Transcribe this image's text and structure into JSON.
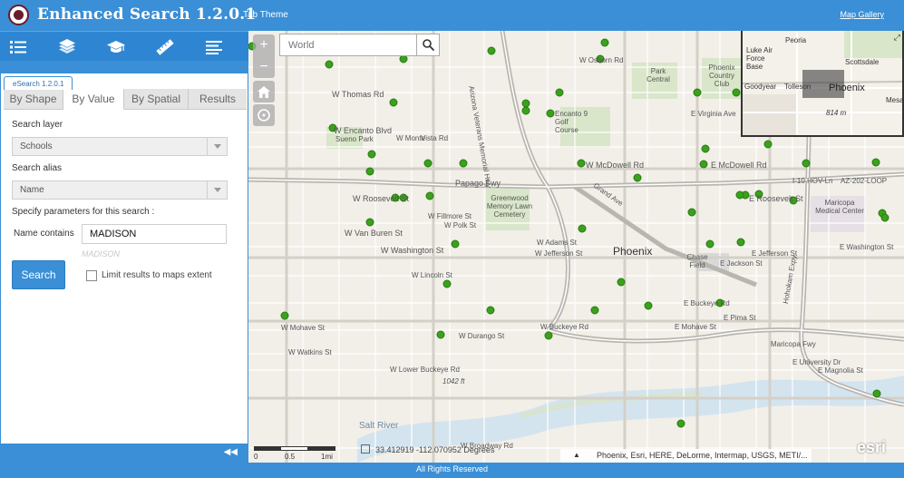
{
  "header": {
    "title": "Enhanced Search 1.2.0.1",
    "theme_label": "Tab Theme",
    "gallery_link": "Map Gallery"
  },
  "toolbar": {
    "tools": [
      "legend-icon",
      "layers-icon",
      "education-icon",
      "ruler-icon",
      "menu-icon"
    ]
  },
  "panel": {
    "widget_tab": "eSearch 1.2.0.1",
    "tabs": [
      {
        "label": "By Shape",
        "active": false
      },
      {
        "label": "By Value",
        "active": true
      },
      {
        "label": "By Spatial",
        "active": false
      },
      {
        "label": "Results",
        "active": false
      }
    ],
    "search_layer_label": "Search layer",
    "search_layer_value": "Schools",
    "search_alias_label": "Search alias",
    "search_alias_value": "Name",
    "params_label": "Specify parameters for this search :",
    "name_contains_label": "Name contains",
    "name_contains_value": "MADISON",
    "name_contains_hint": "MADISON",
    "search_button": "Search",
    "limit_label": "Limit results to maps extent",
    "limit_checked": false
  },
  "map": {
    "search_placeholder": "World",
    "zoom_in": "+",
    "zoom_out": "−",
    "city_label": "Phoenix",
    "street_labels": [
      "W Osborn Rd",
      "W Thomas Rd",
      "W Encanto Blvd",
      "W Monte",
      "Vista Rd",
      "W McDowell Rd",
      "E McDowell Rd",
      "Papago Fwy",
      "W Roosevelt St",
      "E Roosevelt St",
      "W Fillmore St",
      "W Polk St",
      "W Van Buren St",
      "W Adams St",
      "W Jefferson St",
      "E Jefferson St",
      "E Jackson St",
      "W Washington St",
      "E Washington St",
      "W Lincoln St",
      "W Buckeye Rd",
      "E Buckeye Rd",
      "W Mohave St",
      "E Mohave St",
      "E Pima St",
      "W Durango St",
      "W Watkins St",
      "W Lower Buckeye Rd",
      "W Broadway Rd",
      "E University Dr",
      "E Magnolia St",
      "I-10 HOV-Ln",
      "AZ-202-LOOP",
      "Maricopa Fwy",
      "Grand Ave",
      "Arizona Veterans Memorial Hwy",
      "Greenwood Memory Lawn Cemetery",
      "Encanto 9 Golf Course",
      "Park Central",
      "Phoenix Country Club",
      "Chase Field",
      "Maricopa Medical Center",
      "Sueno Park",
      "Salt River",
      "1042 ft",
      "E Virginia Ave",
      "Hohokam Expy"
    ],
    "overview": {
      "labels": [
        "Peoria",
        "Scottsdale",
        "Luke Air Force Base",
        "Goodyear",
        "Tolleson",
        "Phoenix",
        "Mesa",
        "814 m"
      ]
    },
    "scale_labels": [
      "0",
      "0.5",
      "1mi"
    ],
    "coordinates": "33.412919  -112.070952 Degrees",
    "attribution": "Phoenix, Esri, HERE, DeLorme, Intermap, USGS, METI/...",
    "esri_logo": "esri"
  },
  "footer": {
    "text": "All Rights Reserved"
  },
  "colors": {
    "brand": "#3a8fd6",
    "marker": "#3ba11c"
  }
}
